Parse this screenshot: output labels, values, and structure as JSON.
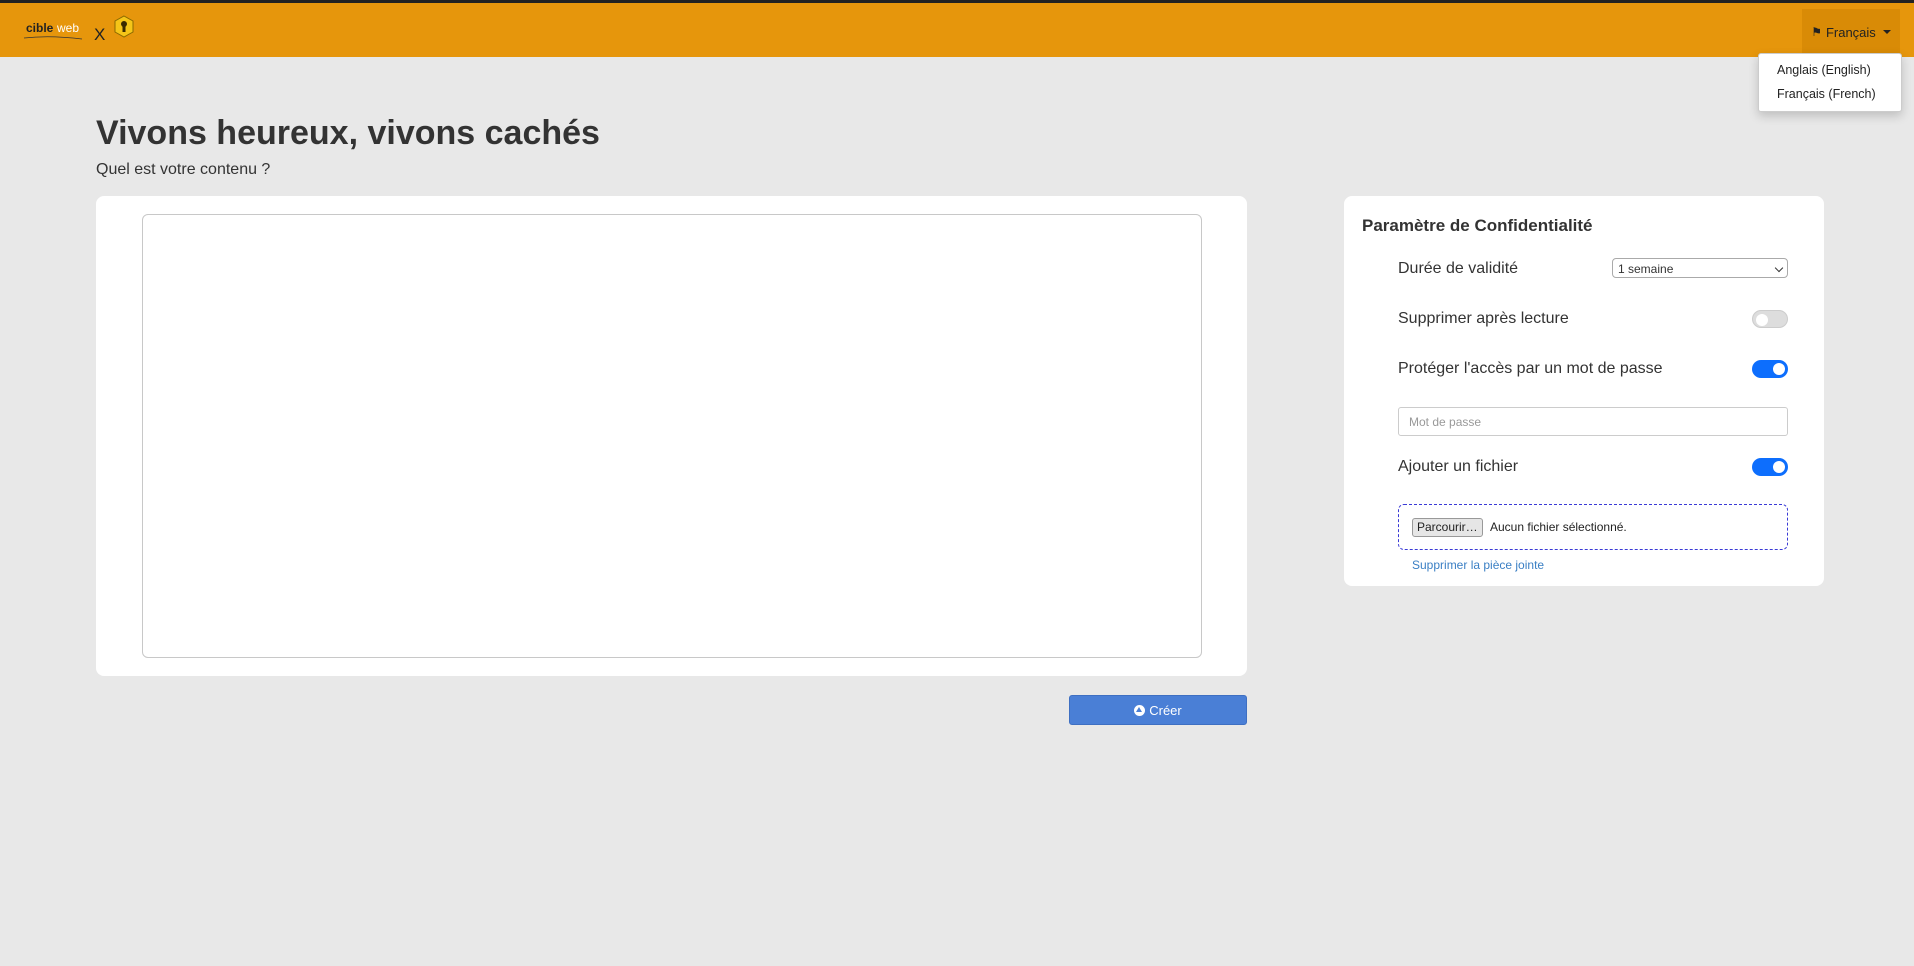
{
  "navbar": {
    "logo_text": "cibleweb",
    "logo_separator": "X",
    "language_button": "Français",
    "language_options": [
      "Anglais (English)",
      "Français (French)"
    ]
  },
  "main": {
    "title": "Vivons heureux, vivons cachés",
    "subtitle": "Quel est votre contenu ?",
    "create_button": "Créer"
  },
  "settings": {
    "title": "Paramètre de Confidentialité",
    "validity_label": "Durée de validité",
    "validity_value": "1 semaine",
    "delete_after_read_label": "Supprimer après lecture",
    "delete_after_read_on": false,
    "password_protect_label": "Protéger l'accès par un mot de passe",
    "password_protect_on": true,
    "password_placeholder": "Mot de passe",
    "add_file_label": "Ajouter un fichier",
    "add_file_on": true,
    "browse_button": "Parcourir…",
    "file_status": "Aucun fichier sélectionné.",
    "remove_attachment": "Supprimer la pièce jointe"
  },
  "colors": {
    "navbar": "#e6960c",
    "primary_button": "#4a7fd6",
    "toggle_on": "#0d6efd"
  }
}
